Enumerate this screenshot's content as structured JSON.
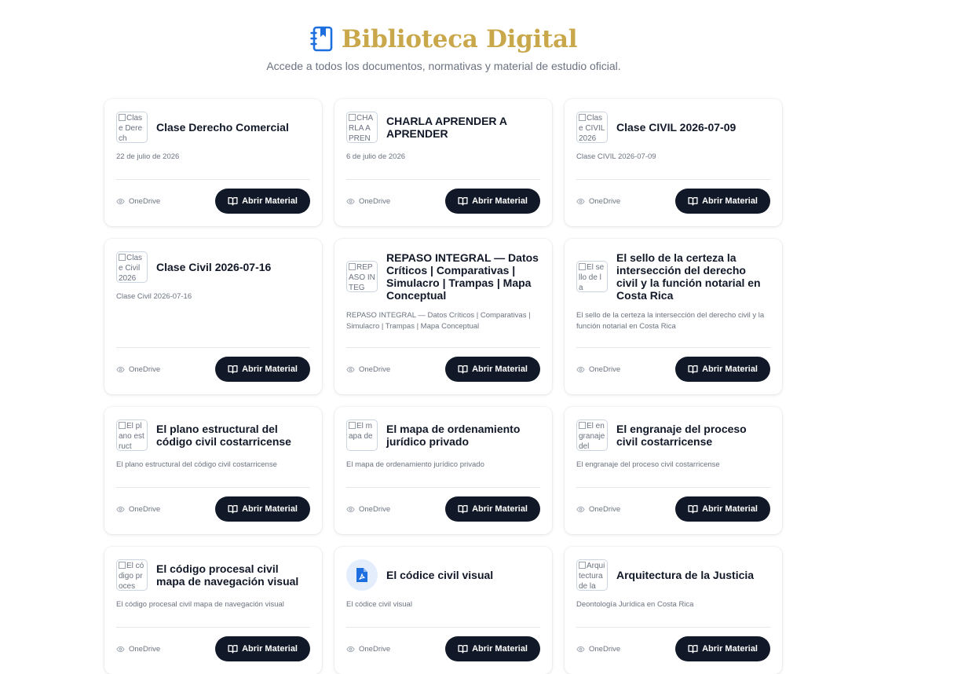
{
  "header": {
    "title": "Biblioteca Digital",
    "subtitle": "Accede a todos los documentos, normativas y material de estudio oficial.",
    "icon": "book-bookmark-icon",
    "title_color": "#c9a84c",
    "icon_color": "#1d6fe0"
  },
  "cards": [
    {
      "thumb_alt": "Clase Derech",
      "title": "Clase Derecho Comercial",
      "desc": "22 de julio de 2026",
      "source": "OneDrive",
      "button": "Abrir Material"
    },
    {
      "thumb_alt": "CHARLA APREN",
      "title": "CHARLA APRENDER A APRENDER",
      "desc": "6 de julio de 2026",
      "source": "OneDrive",
      "button": "Abrir Material"
    },
    {
      "thumb_alt": "Clase CIVIL 2026",
      "title": "Clase CIVIL 2026-07-09",
      "desc": "Clase CIVIL 2026-07-09",
      "source": "OneDrive",
      "button": "Abrir Material"
    },
    {
      "thumb_alt": "Clase Civil 2026",
      "title": "Clase Civil 2026-07-16",
      "desc": "Clase Civil 2026-07-16",
      "source": "OneDrive",
      "button": "Abrir Material"
    },
    {
      "thumb_alt": "REPASO INTEG",
      "title": "REPASO INTEGRAL — Datos Críticos | Comparativas | Simulacro | Trampas | Mapa Conceptual",
      "desc": "REPASO INTEGRAL — Datos Críticos | Comparativas | Simulacro | Trampas | Mapa Conceptual",
      "source": "OneDrive",
      "button": "Abrir Material"
    },
    {
      "thumb_alt": "El sello de la",
      "title": "El sello de la certeza la intersección del derecho civil y la función notarial en Costa Rica",
      "desc": "El sello de la certeza la intersección del derecho civil y la función notarial en Costa Rica",
      "source": "OneDrive",
      "button": "Abrir Material"
    },
    {
      "thumb_alt": "El plano estruct",
      "title": "El plano estructural del código civil costarricense",
      "desc": "El plano estructural del código civil costarricense",
      "source": "OneDrive",
      "button": "Abrir Material"
    },
    {
      "thumb_alt": "El mapa de",
      "title": "El mapa de ordenamiento jurídico privado",
      "desc": "El mapa de ordenamiento jurídico privado",
      "source": "OneDrive",
      "button": "Abrir Material"
    },
    {
      "thumb_alt": "El engranaje del",
      "title": "El engranaje del proceso civil costarricense",
      "desc": "El engranaje del proceso civil costarricense",
      "source": "OneDrive",
      "button": "Abrir Material"
    },
    {
      "thumb_alt": "El código proces",
      "title": "El código procesal civil mapa de navegación visual",
      "desc": "El código procesal civil mapa de navegación visual",
      "source": "OneDrive",
      "button": "Abrir Material"
    },
    {
      "thumb_type": "pdf",
      "thumb_icon": "pdf-file-icon",
      "title": "El códice civil visual",
      "desc": "El códice civil visual",
      "source": "OneDrive",
      "button": "Abrir Material"
    },
    {
      "thumb_alt": "Arquitectura de la",
      "title": "Arquitectura de la Justicia",
      "desc": "Deontología Jurídica en Costa Rica",
      "source": "OneDrive",
      "button": "Abrir Material"
    }
  ]
}
